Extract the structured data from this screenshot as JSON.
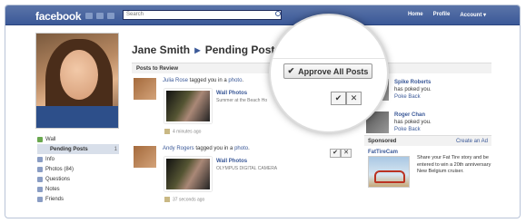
{
  "brand": {
    "logo": "facebook",
    "accent": "#3b5998"
  },
  "header": {
    "search_placeholder": "Search",
    "nav": [
      "Home",
      "Profile",
      "Account ▾"
    ]
  },
  "sidebar": {
    "items": [
      {
        "label": "Wall",
        "icon": "wall-icon"
      },
      {
        "label": "Pending Posts",
        "count": "1",
        "icon": "pending-icon"
      },
      {
        "label": "Info",
        "icon": "info-icon"
      },
      {
        "label": "Photos (84)",
        "icon": "photos-icon"
      },
      {
        "label": "Questions",
        "icon": "questions-icon"
      },
      {
        "label": "Notes",
        "icon": "notes-icon"
      },
      {
        "label": "Friends",
        "icon": "friends-icon"
      }
    ]
  },
  "page": {
    "owner": "Jane Smith",
    "separator": "▸",
    "title": "Pending Posts",
    "section": "Posts to Review"
  },
  "posts": [
    {
      "author": "Julia Rose",
      "verb": " tagged you in a ",
      "object": "photo",
      "album": "Wall Photos",
      "caption": "Summer at the Beach Ho",
      "time": "4 minutes ago"
    },
    {
      "author": "Andy Rogers",
      "verb": " tagged you in a ",
      "object": "photo",
      "album": "Wall Photos",
      "caption": "OLYMPUS DIGITAL CAMERA",
      "time": "37 seconds ago"
    }
  ],
  "actions": {
    "approve_all": "Approve All Posts",
    "check": "✔",
    "dismiss": "✕"
  },
  "pokes": [
    {
      "name": "Spike Roberts",
      "action": "has poked you.",
      "back": "Poke Back"
    },
    {
      "name": "Roger Chan",
      "action": "has poked you.",
      "back": "Poke Back"
    }
  ],
  "sponsored": {
    "label": "Sponsored",
    "create": "Create an Ad",
    "ad_title": "FatTireCam",
    "ad_text": "Share your Fat Tire story and be entered to win a 20th anniversary New Belgium cruiser."
  }
}
